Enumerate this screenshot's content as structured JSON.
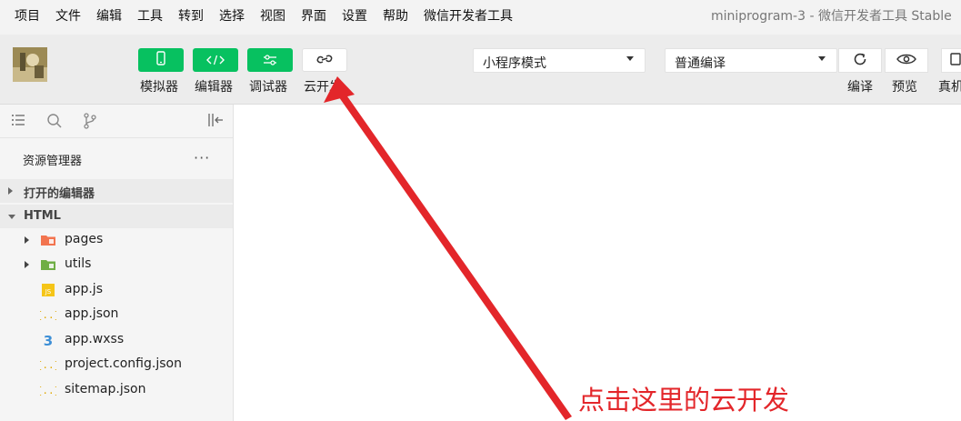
{
  "menubar": {
    "items": [
      "项目",
      "文件",
      "编辑",
      "工具",
      "转到",
      "选择",
      "视图",
      "界面",
      "设置",
      "帮助",
      "微信开发者工具"
    ],
    "window_title": "miniprogram-3 - 微信开发者工具 Stable"
  },
  "toolbar": {
    "tools": [
      {
        "label": "模拟器",
        "icon": "phone-icon"
      },
      {
        "label": "编辑器",
        "icon": "code-icon"
      },
      {
        "label": "调试器",
        "icon": "sliders-icon"
      },
      {
        "label": "云开发",
        "icon": "cloud-link-icon"
      }
    ],
    "mode_select": {
      "value": "小程序模式"
    },
    "compile_select": {
      "value": "普通编译"
    },
    "actions": [
      {
        "label": "编译",
        "icon": "refresh-icon"
      },
      {
        "label": "预览",
        "icon": "eye-icon"
      },
      {
        "label": "真机",
        "icon": "device-icon"
      }
    ],
    "accent_color": "#07c160"
  },
  "sidebar": {
    "explorer_title": "资源管理器",
    "more_label": "···",
    "open_editors": "打开的编辑器",
    "project": "HTML",
    "files": [
      {
        "name": "pages",
        "icon": "folder-orange-icon",
        "expandable": true
      },
      {
        "name": "utils",
        "icon": "folder-green-icon",
        "expandable": true
      },
      {
        "name": "app.js",
        "icon": "js-file-icon",
        "expandable": false
      },
      {
        "name": "app.json",
        "icon": "json-file-icon",
        "expandable": false
      },
      {
        "name": "app.wxss",
        "icon": "css-file-icon",
        "expandable": false
      },
      {
        "name": "project.config.json",
        "icon": "json-file-icon",
        "expandable": false
      },
      {
        "name": "sitemap.json",
        "icon": "json-file-icon",
        "expandable": false
      }
    ]
  },
  "annotation": {
    "text": "点击这里的云开发",
    "color": "#e3262a"
  }
}
